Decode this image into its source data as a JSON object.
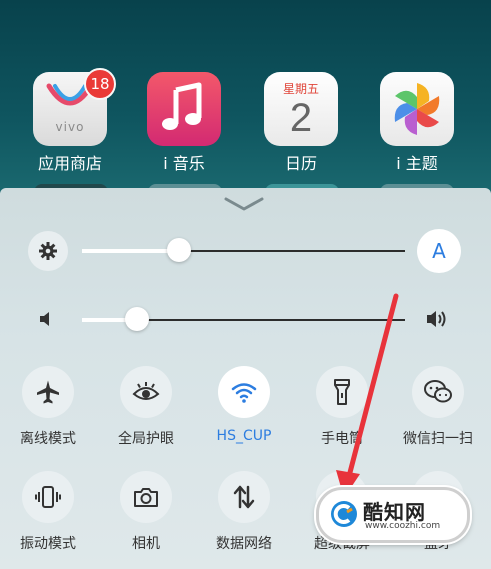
{
  "homescreen": {
    "apps": [
      {
        "label": "应用商店",
        "badge": "18",
        "logo_text": "vivo"
      },
      {
        "label": "i 音乐"
      },
      {
        "label": "日历",
        "weekday": "星期五",
        "day": "2"
      },
      {
        "label": "i 主题"
      }
    ]
  },
  "control_center": {
    "brightness": {
      "level": 0.3,
      "auto_label": "A"
    },
    "volume": {
      "level": 0.17
    },
    "toggles": [
      {
        "label": "离线模式",
        "icon": "airplane-icon",
        "active": false
      },
      {
        "label": "全局护眼",
        "icon": "eye-icon",
        "active": false
      },
      {
        "label": "HS_CUP",
        "icon": "wifi-icon",
        "active": true
      },
      {
        "label": "手电筒",
        "icon": "flashlight-icon",
        "active": false
      },
      {
        "label": "微信扫一扫",
        "icon": "wechat-icon",
        "active": false
      },
      {
        "label": "振动模式",
        "icon": "vibrate-icon",
        "active": false
      },
      {
        "label": "相机",
        "icon": "camera-icon",
        "active": false
      },
      {
        "label": "数据网络",
        "icon": "mobile-data-icon",
        "active": false
      },
      {
        "label": "超级截屏",
        "icon": "screenshot-icon",
        "active": false
      },
      {
        "label": "蓝牙",
        "icon": "bluetooth-icon",
        "active": false
      }
    ]
  },
  "watermark": {
    "name": "酷知网",
    "url": "www.coozhi.com"
  },
  "colors": {
    "accent": "#2c7de0",
    "arrow": "#e8333b",
    "badge": "#ea3a37"
  }
}
